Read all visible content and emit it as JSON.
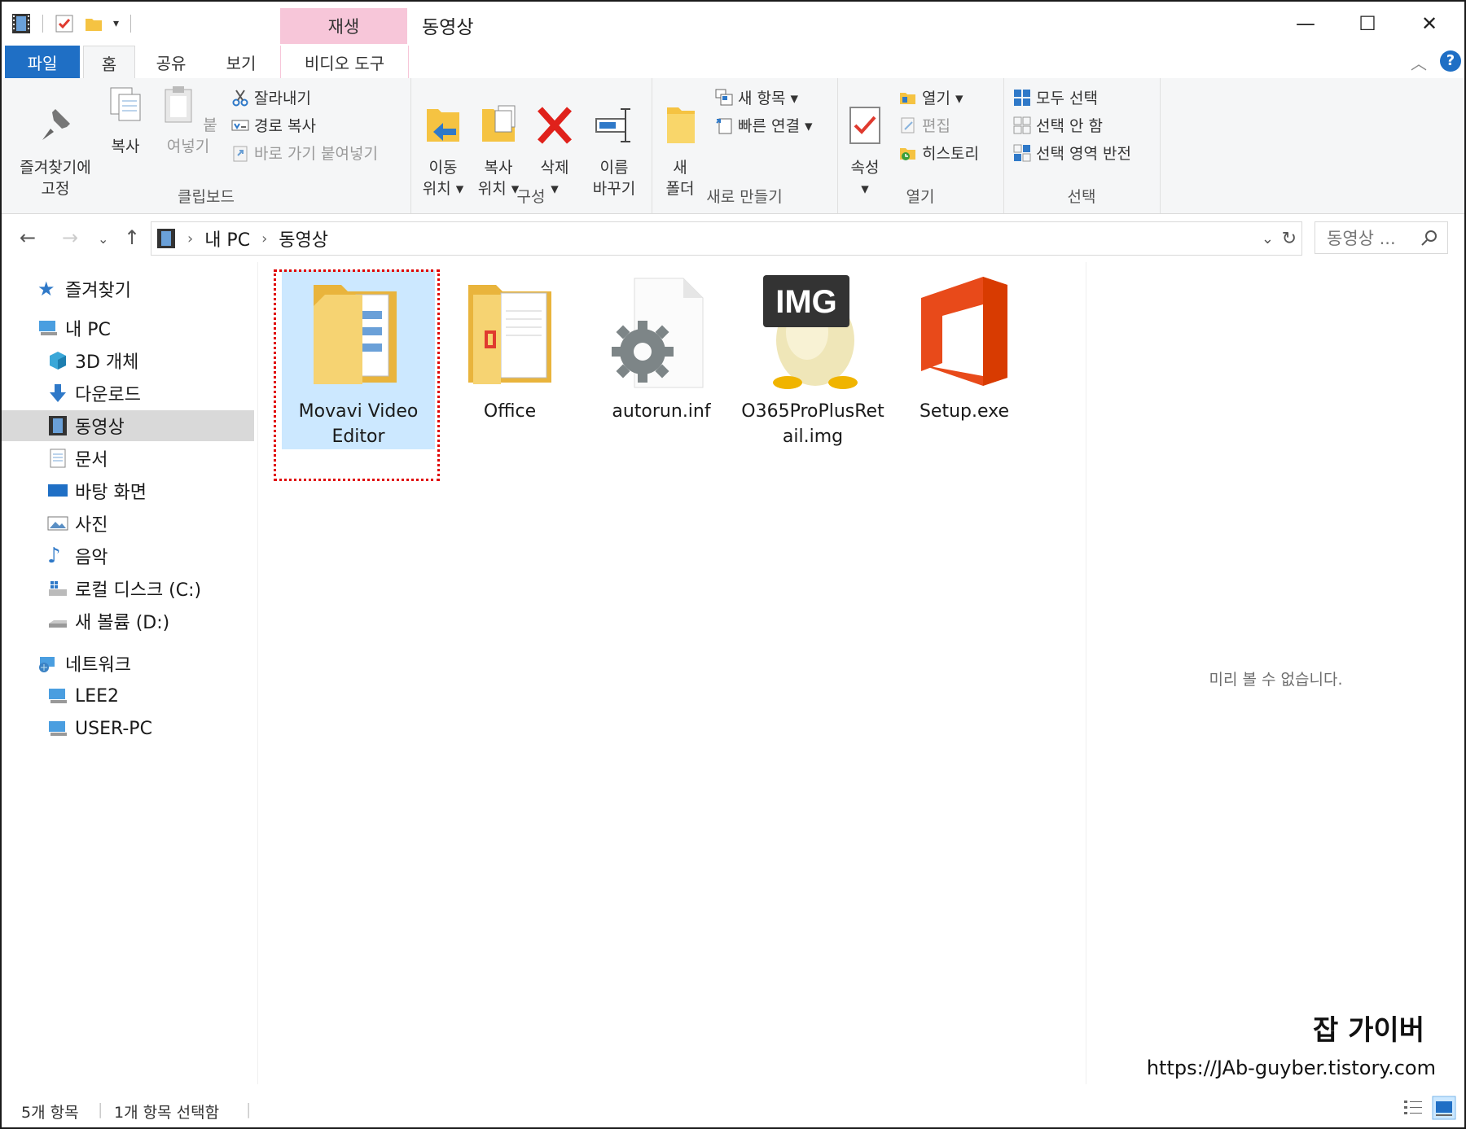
{
  "window": {
    "title": "동영상",
    "context_tab_header": "재생",
    "minimize": "—",
    "maximize": "☐",
    "close": "✕"
  },
  "tabs": [
    "파일",
    "홈",
    "공유",
    "보기",
    "비디오 도구"
  ],
  "ribbon": {
    "clipboard": {
      "label": "클립보드",
      "pin": "즐겨찾기에\n고정",
      "copy": "복사",
      "paste": "붙여넣기",
      "cut": "잘라내기",
      "copy_path": "경로 복사",
      "paste_shortcut": "바로 가기 붙여넣기"
    },
    "organize": {
      "label": "구성",
      "move_to": "이동\n위치 ▾",
      "copy_to": "복사\n위치 ▾",
      "delete": "삭제\n▾",
      "rename": "이름\n바꾸기"
    },
    "new": {
      "label": "새로 만들기",
      "new_folder": "새\n폴더",
      "new_item": "새 항목 ▾",
      "easy_access": "빠른 연결 ▾"
    },
    "open": {
      "label": "열기",
      "properties": "속성\n▾",
      "open": "열기 ▾",
      "edit": "편집",
      "history": "히스토리"
    },
    "select": {
      "label": "선택",
      "select_all": "모두 선택",
      "select_none": "선택 안 함",
      "invert": "선택 영역 반전"
    }
  },
  "address": {
    "crumbs": [
      "내 PC",
      "동영상"
    ],
    "search_placeholder": "동영상 ..."
  },
  "nav": {
    "quick_access": "즐겨찾기",
    "this_pc": "내 PC",
    "objects3d": "3D 개체",
    "downloads": "다운로드",
    "videos": "동영상",
    "documents": "문서",
    "desktop": "바탕 화면",
    "pictures": "사진",
    "music": "음악",
    "local_disk": "로컬 디스크 (C:)",
    "new_volume": "새 볼륨 (D:)",
    "network": "네트워크",
    "lee2": "LEE2",
    "user_pc": "USER-PC"
  },
  "files": [
    {
      "name": "Movavi Video Editor",
      "type": "folder",
      "selected": true
    },
    {
      "name": "Office",
      "type": "folder"
    },
    {
      "name": "autorun.inf",
      "type": "settings"
    },
    {
      "name": "O365ProPlusRetail.img",
      "type": "img",
      "badge": "IMG"
    },
    {
      "name": "Setup.exe",
      "type": "office-exe"
    }
  ],
  "preview": {
    "message": "미리 볼 수 없습니다."
  },
  "watermark": {
    "title": "잡 가이버",
    "url": "https://JAb-guyber.tistory.com"
  },
  "status": {
    "count": "5개 항목",
    "selected": "1개 항목 선택함"
  },
  "colors": {
    "accent": "#1f6fc5",
    "context_tab": "#f7c6d9",
    "selection": "#cce8ff",
    "highlight_box": "#e00000"
  }
}
